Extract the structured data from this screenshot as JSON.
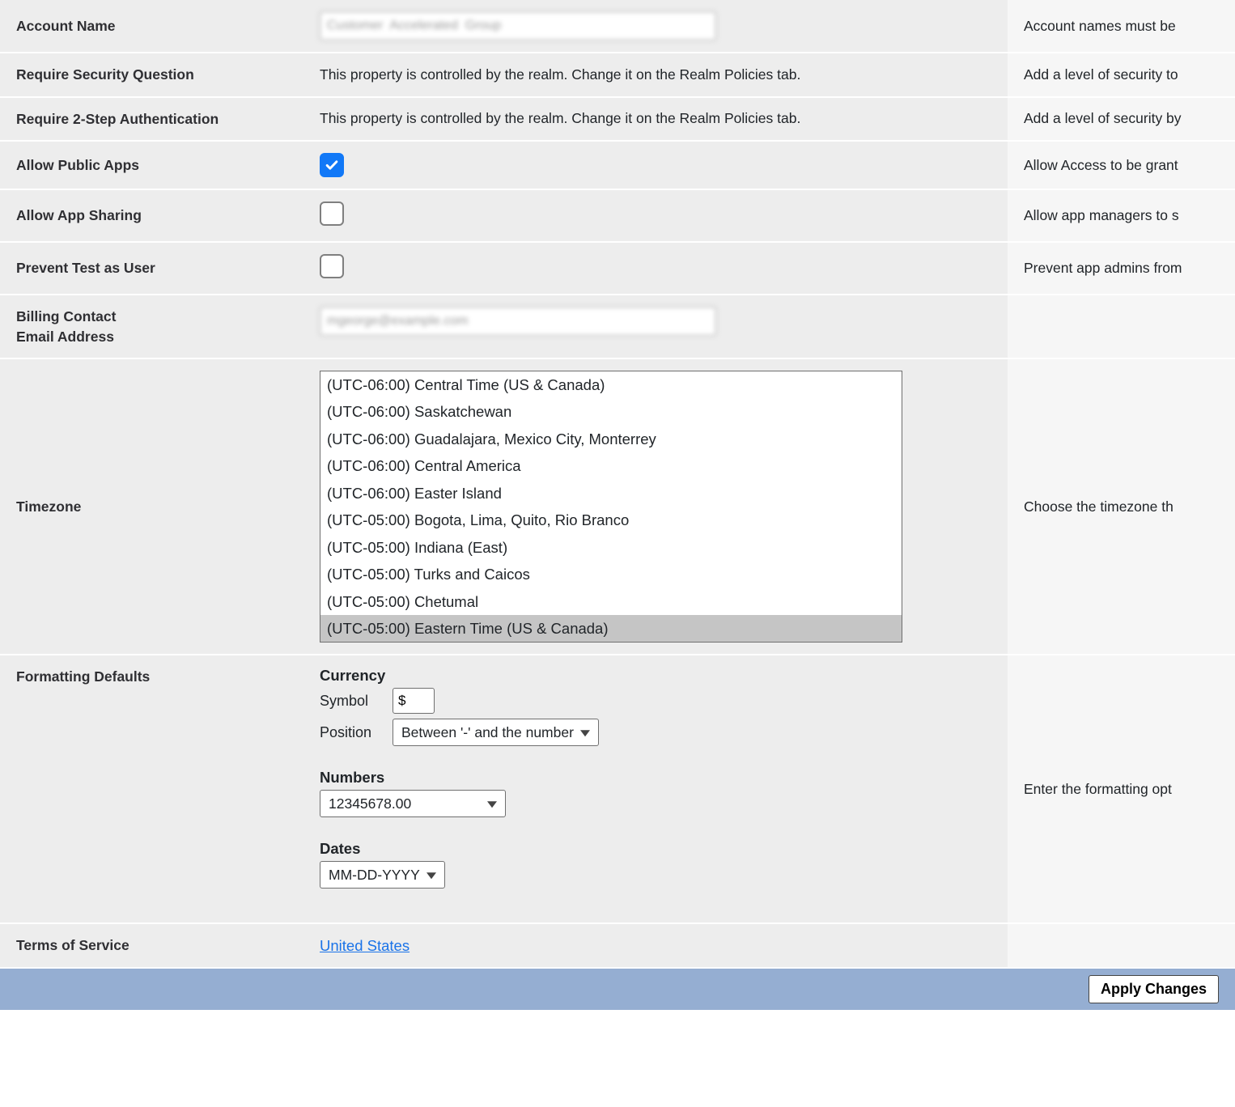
{
  "rows": {
    "account_name": {
      "label": "Account Name",
      "value_blurred": "Customer  Accelerated  Group",
      "help": "Account names must be"
    },
    "require_security_question": {
      "label": "Require Security Question",
      "value_text": "This property is controlled by the realm. Change it on the Realm Policies tab.",
      "help": "Add a level of security to"
    },
    "require_2step": {
      "label": "Require 2-Step Authentication",
      "value_text": "This property is controlled by the realm. Change it on the Realm Policies tab.",
      "help": "Add a level of security by"
    },
    "allow_public_apps": {
      "label": "Allow Public Apps",
      "checked": true,
      "help": "Allow Access to be grant"
    },
    "allow_app_sharing": {
      "label": "Allow App Sharing",
      "checked": false,
      "help": "Allow app managers to s"
    },
    "prevent_test_user": {
      "label": "Prevent Test as User",
      "checked": false,
      "help": "Prevent app admins from"
    },
    "billing_email": {
      "label_line1": "Billing Contact",
      "label_line2": "Email Address",
      "value_blurred": "mgeorge@example.com",
      "help": ""
    },
    "timezone": {
      "label": "Timezone",
      "help": "Choose the timezone th",
      "options": [
        "(UTC-06:00) Central Time (US & Canada)",
        "(UTC-06:00) Saskatchewan",
        "(UTC-06:00) Guadalajara, Mexico City, Monterrey",
        "(UTC-06:00) Central America",
        "(UTC-06:00) Easter Island",
        "(UTC-05:00) Bogota, Lima, Quito, Rio Branco",
        "(UTC-05:00) Indiana (East)",
        "(UTC-05:00) Turks and Caicos",
        "(UTC-05:00) Chetumal",
        "(UTC-05:00) Eastern Time (US & Canada)"
      ],
      "selected_index": 9
    },
    "formatting": {
      "label": "Formatting Defaults",
      "help": "Enter the formatting opt",
      "currency_heading": "Currency",
      "symbol_label": "Symbol",
      "symbol_value": "$",
      "position_label": "Position",
      "position_value": "Between '-' and the number",
      "numbers_heading": "Numbers",
      "numbers_value": "12345678.00",
      "dates_heading": "Dates",
      "dates_value": "MM-DD-YYYY"
    },
    "terms": {
      "label": "Terms of Service",
      "link_text": "United States",
      "help": ""
    }
  },
  "footer": {
    "apply_label": "Apply Changes"
  }
}
